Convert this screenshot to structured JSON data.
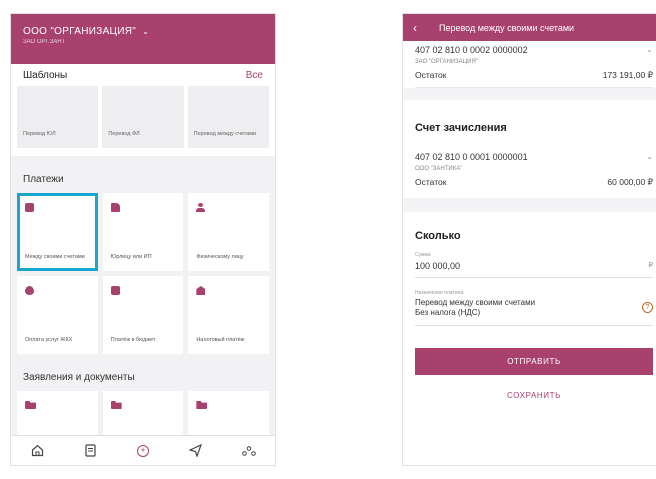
{
  "left": {
    "header": {
      "org_name": "ООО \"ОРГАНИЗАЦИЯ\"",
      "org_sub": "ЗАО ОРГ.ЗАНТ"
    },
    "templates": {
      "title": "Шаблоны",
      "all_label": "Все",
      "items": [
        {
          "label": "Перевод ЮЛ"
        },
        {
          "label": "Перевод ФЛ"
        },
        {
          "label": "Перевод между счетами"
        }
      ]
    },
    "payments": {
      "title": "Платежи",
      "items": [
        {
          "label": "Между своими счетами",
          "icon": "transfer-icon"
        },
        {
          "label": "Юрлицу или ИП",
          "icon": "document-icon"
        },
        {
          "label": "Физическому лицу",
          "icon": "person-icon"
        },
        {
          "label": "Оплата услуг ЖКХ",
          "icon": "drop-icon"
        },
        {
          "label": "Платёж в бюджет",
          "icon": "briefcase-icon"
        },
        {
          "label": "Налоговый платёж",
          "icon": "bank-icon"
        }
      ]
    },
    "documents": {
      "title": "Заявления и документы"
    },
    "tabbar": [
      "home-icon",
      "document-icon",
      "add-icon",
      "send-icon",
      "more-icon"
    ]
  },
  "right": {
    "header": {
      "title": "Перевод между своими счетами",
      "back": "‹"
    },
    "from_account": {
      "number": "407 02 810 0 0002 0000002",
      "owner": "ЗАО \"ОРГАНИЗАЦИЯ\"",
      "balance_label": "Остаток",
      "balance": "173 191,00 ₽"
    },
    "to_section_title": "Счет зачисления",
    "to_account": {
      "number": "407 02 810 0 0001 0000001",
      "owner": "ООО \"ЗАНТИКА\"",
      "balance_label": "Остаток",
      "balance": "60 000,00 ₽"
    },
    "amount": {
      "section_title": "Сколько",
      "field_label": "Сумма",
      "value": "100 000,00",
      "currency": "₽"
    },
    "purpose": {
      "field_label": "Назначение платежа",
      "line1": "Перевод между своими счетами",
      "line2": "Без налога (НДС)"
    },
    "send_label": "ОТПРАВИТЬ",
    "save_label": "СОХРАНИТЬ"
  },
  "colors": {
    "accent": "#a8416d",
    "selection": "#1aa6cf"
  }
}
